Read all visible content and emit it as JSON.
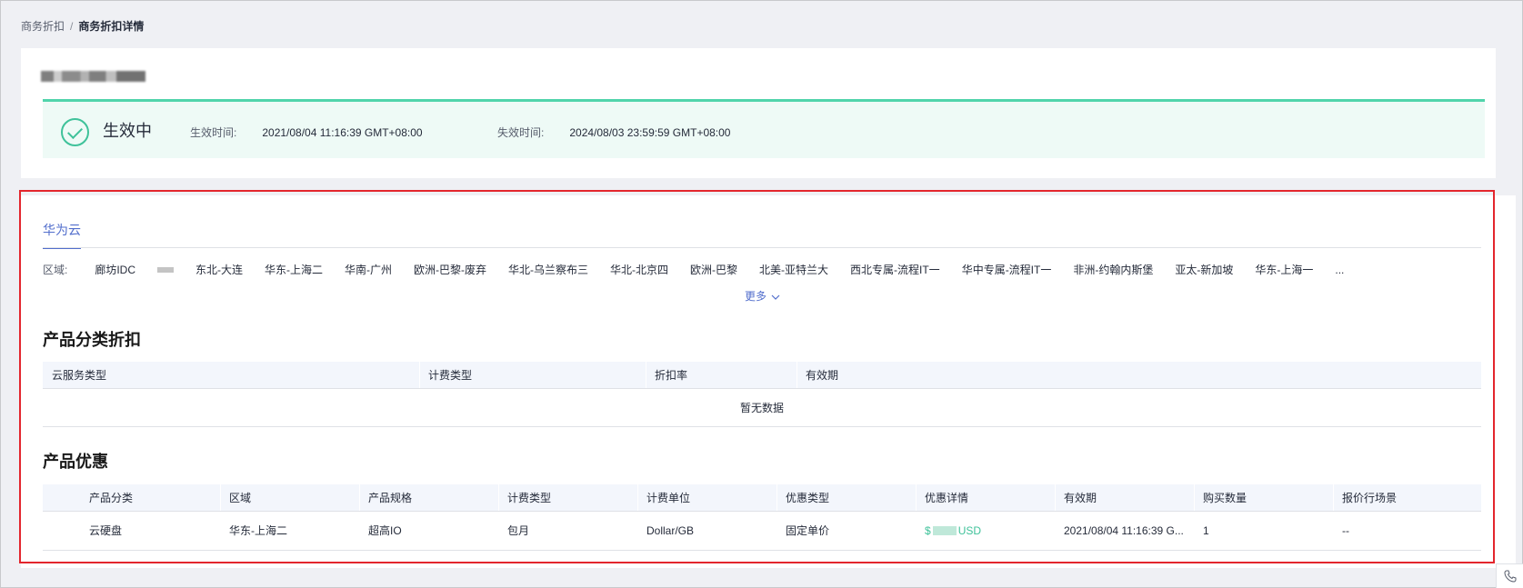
{
  "breadcrumb": {
    "parent": "商务折扣",
    "separator": "/",
    "current": "商务折扣详情"
  },
  "status": {
    "label": "生效中",
    "start_label": "生效时间:",
    "start_value": "2021/08/04 11:16:39 GMT+08:00",
    "end_label": "失效时间:",
    "end_value": "2024/08/03 23:59:59 GMT+08:00",
    "color": "#3fc29a"
  },
  "tab": {
    "label": "华为云",
    "color": "#526ecc"
  },
  "regions": {
    "label": "区域:",
    "items": [
      "廊坊IDC",
      "东北-大连",
      "华东-上海二",
      "华南-广州",
      "欧洲-巴黎-废弃",
      "华北-乌兰察布三",
      "华北-北京四",
      "欧洲-巴黎",
      "北美-亚特兰大",
      "西北专属-流程IT一",
      "华中专属-流程IT一",
      "非洲-约翰内斯堡",
      "亚太-新加坡",
      "华东-上海一",
      "..."
    ],
    "more_label": "更多"
  },
  "category_discount": {
    "title": "产品分类折扣",
    "columns": [
      "云服务类型",
      "计费类型",
      "折扣率",
      "有效期"
    ],
    "empty_text": "暂无数据"
  },
  "product_offer": {
    "title": "产品优惠",
    "columns": [
      "产品分类",
      "区域",
      "产品规格",
      "计费类型",
      "计费单位",
      "优惠类型",
      "优惠详情",
      "有效期",
      "购买数量",
      "报价行场景"
    ],
    "rows": [
      {
        "category": "云硬盘",
        "region": "华东-上海二",
        "spec": "超高IO",
        "billing": "包月",
        "unit": "Dollar/GB",
        "offer_type": "固定单价",
        "detail_prefix": "$",
        "detail_suffix": "USD",
        "validity": "2021/08/04 11:16:39 G...",
        "quantity": "1",
        "scene": "--"
      }
    ]
  },
  "highlight_color": "#e3262d"
}
